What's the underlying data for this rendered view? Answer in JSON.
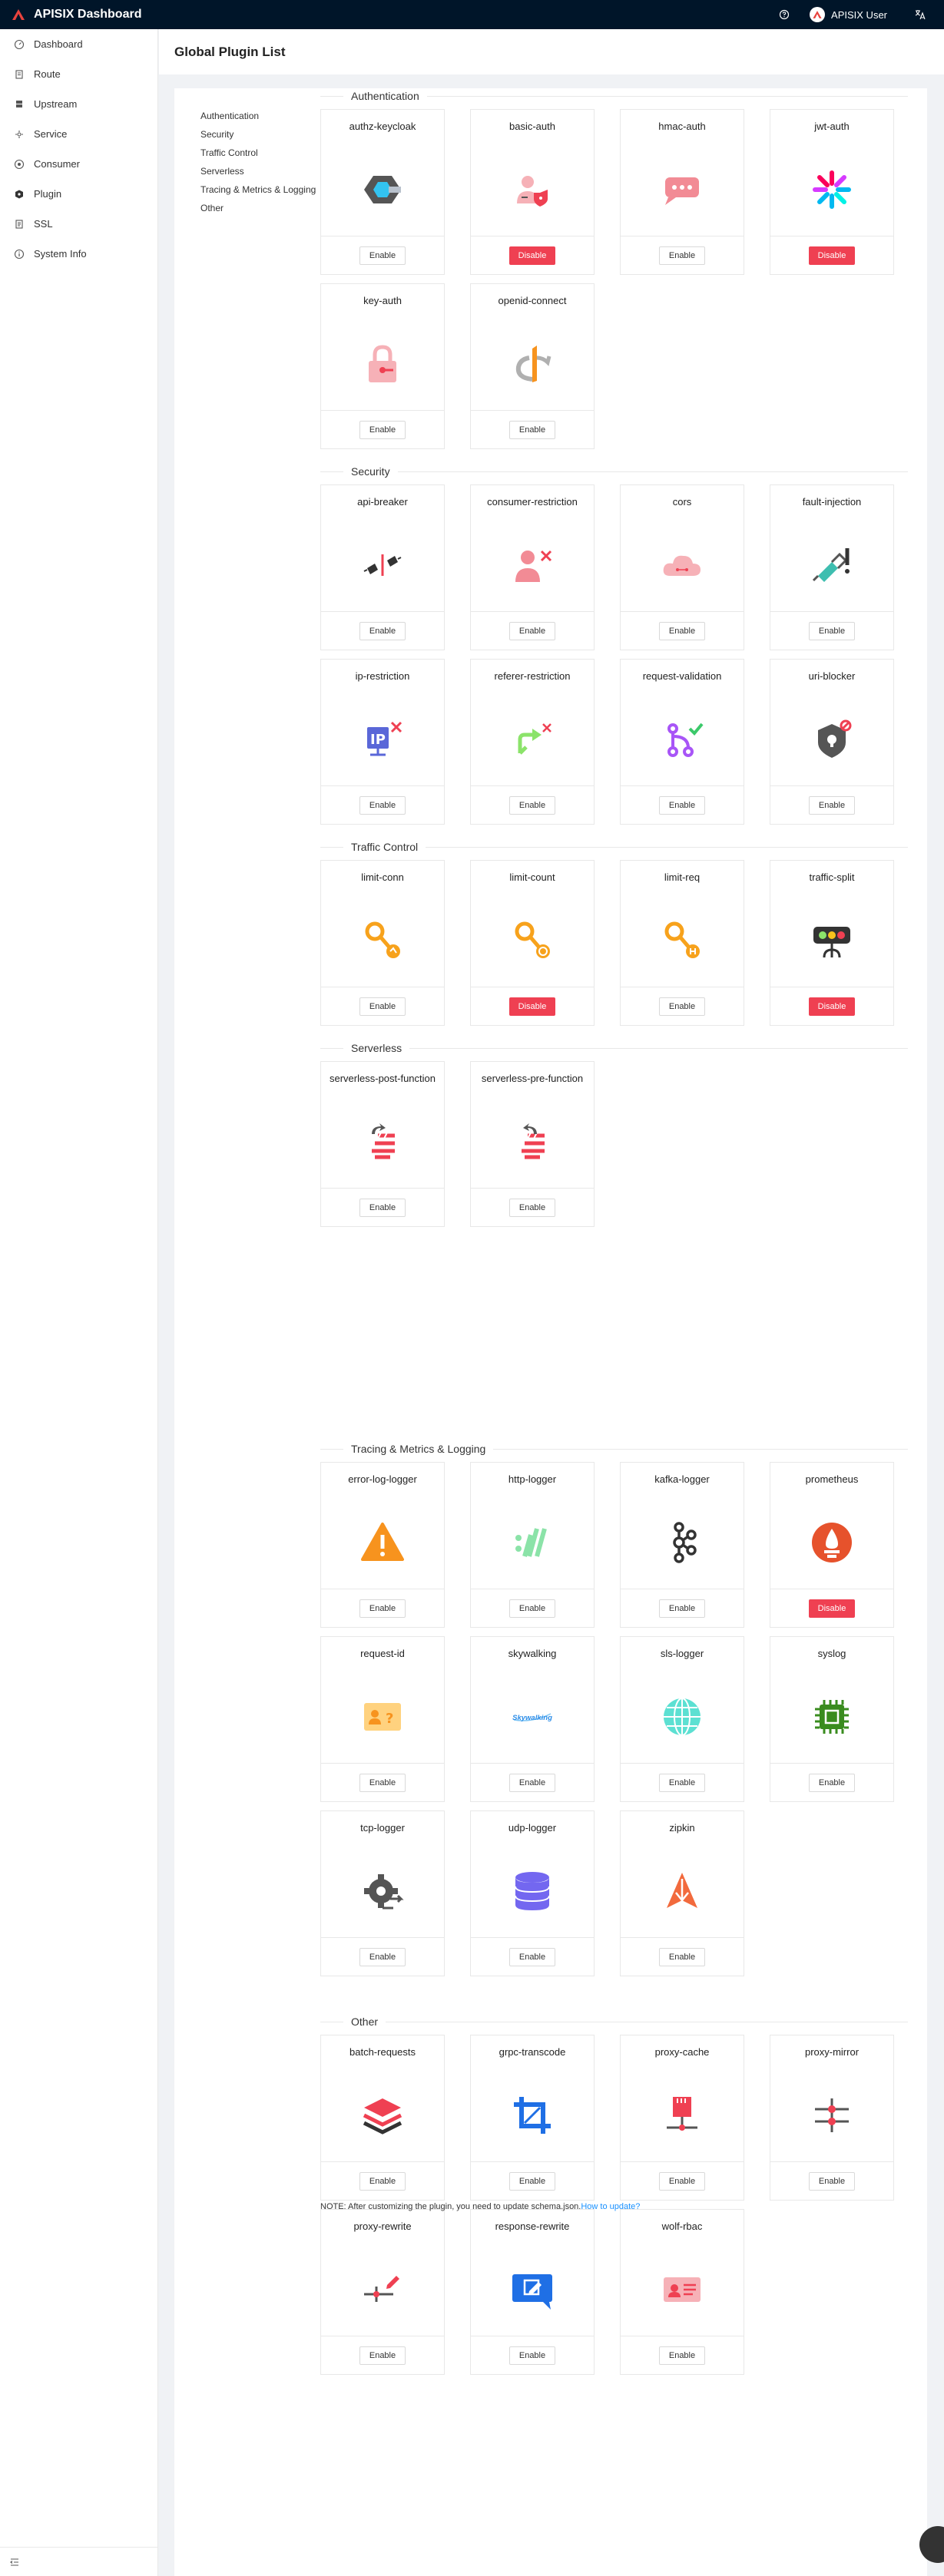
{
  "app": {
    "title": "APISIX Dashboard",
    "user": "APISIX User",
    "brand_color": "#001529",
    "accent_color": "#ef4052",
    "link_color": "#1890ff"
  },
  "sidebar": {
    "items": [
      {
        "label": "Dashboard",
        "icon": "dashboard-icon"
      },
      {
        "label": "Route",
        "icon": "route-icon"
      },
      {
        "label": "Upstream",
        "icon": "upstream-icon"
      },
      {
        "label": "Service",
        "icon": "service-icon"
      },
      {
        "label": "Consumer",
        "icon": "consumer-icon"
      },
      {
        "label": "Plugin",
        "icon": "plugin-icon"
      },
      {
        "label": "SSL",
        "icon": "ssl-icon"
      },
      {
        "label": "System Info",
        "icon": "info-icon"
      }
    ]
  },
  "page": {
    "title": "Global Plugin List"
  },
  "anchor": [
    "Authentication",
    "Security",
    "Traffic Control",
    "Serverless",
    "Tracing & Metrics & Logging",
    "Other"
  ],
  "buttons": {
    "enable": "Enable",
    "disable": "Disable"
  },
  "sections": [
    {
      "title": "Authentication",
      "plugins": [
        {
          "name": "authz-keycloak",
          "state": "Enable",
          "icon": "keycloak-icon"
        },
        {
          "name": "basic-auth",
          "state": "Disable",
          "icon": "user-shield-icon"
        },
        {
          "name": "hmac-auth",
          "state": "Enable",
          "icon": "chat-bubble-icon"
        },
        {
          "name": "jwt-auth",
          "state": "Disable",
          "icon": "jwt-icon"
        },
        {
          "name": "key-auth",
          "state": "Enable",
          "icon": "lock-icon"
        },
        {
          "name": "openid-connect",
          "state": "Enable",
          "icon": "openid-icon"
        }
      ]
    },
    {
      "title": "Security",
      "plugins": [
        {
          "name": "api-breaker",
          "state": "Enable",
          "icon": "plug-breaker-icon"
        },
        {
          "name": "consumer-restriction",
          "state": "Enable",
          "icon": "user-x-icon"
        },
        {
          "name": "cors",
          "state": "Enable",
          "icon": "cloud-icon"
        },
        {
          "name": "fault-injection",
          "state": "Enable",
          "icon": "syringe-icon"
        },
        {
          "name": "ip-restriction",
          "state": "Enable",
          "icon": "ip-x-icon"
        },
        {
          "name": "referer-restriction",
          "state": "Enable",
          "icon": "share-x-icon"
        },
        {
          "name": "request-validation",
          "state": "Enable",
          "icon": "branch-check-icon"
        },
        {
          "name": "uri-blocker",
          "state": "Enable",
          "icon": "shield-block-icon"
        }
      ]
    },
    {
      "title": "Traffic Control",
      "plugins": [
        {
          "name": "limit-conn",
          "state": "Enable",
          "icon": "limit-conn-icon"
        },
        {
          "name": "limit-count",
          "state": "Disable",
          "icon": "limit-count-icon"
        },
        {
          "name": "limit-req",
          "state": "Enable",
          "icon": "limit-req-icon"
        },
        {
          "name": "traffic-split",
          "state": "Disable",
          "icon": "traffic-light-icon"
        }
      ]
    },
    {
      "title": "Serverless",
      "plugins": [
        {
          "name": "serverless-post-function",
          "state": "Enable",
          "icon": "function-post-icon"
        },
        {
          "name": "serverless-pre-function",
          "state": "Enable",
          "icon": "function-pre-icon"
        }
      ]
    },
    {
      "title": "Tracing & Metrics & Logging",
      "plugins": [
        {
          "name": "error-log-logger",
          "state": "Enable",
          "icon": "warning-icon"
        },
        {
          "name": "http-logger",
          "state": "Enable",
          "icon": "http-icon"
        },
        {
          "name": "kafka-logger",
          "state": "Enable",
          "icon": "kafka-icon"
        },
        {
          "name": "prometheus",
          "state": "Disable",
          "icon": "prometheus-icon"
        },
        {
          "name": "request-id",
          "state": "Enable",
          "icon": "id-card-icon"
        },
        {
          "name": "skywalking",
          "state": "Enable",
          "icon": "skywalking-icon",
          "logo_text": "Skywalking"
        },
        {
          "name": "sls-logger",
          "state": "Enable",
          "icon": "globe-icon"
        },
        {
          "name": "syslog",
          "state": "Enable",
          "icon": "chip-icon"
        },
        {
          "name": "tcp-logger",
          "state": "Enable",
          "icon": "gear-arrows-icon"
        },
        {
          "name": "udp-logger",
          "state": "Enable",
          "icon": "database-icon"
        },
        {
          "name": "zipkin",
          "state": "Enable",
          "icon": "zipkin-icon"
        }
      ]
    },
    {
      "title": "Other",
      "plugins": [
        {
          "name": "batch-requests",
          "state": "Enable",
          "icon": "layers-icon"
        },
        {
          "name": "grpc-transcode",
          "state": "Enable",
          "icon": "crop-icon"
        },
        {
          "name": "proxy-cache",
          "state": "Enable",
          "icon": "sd-card-icon"
        },
        {
          "name": "proxy-mirror",
          "state": "Enable",
          "icon": "sliders-icon"
        },
        {
          "name": "proxy-rewrite",
          "state": "Enable",
          "icon": "slider-edit-icon"
        },
        {
          "name": "response-rewrite",
          "state": "Enable",
          "icon": "edit-chat-icon"
        },
        {
          "name": "wolf-rbac",
          "state": "Enable",
          "icon": "badge-icon"
        }
      ]
    }
  ],
  "note": {
    "text": "NOTE: After customizing the plugin, you need to update schema.json.",
    "link": "How to update?"
  }
}
